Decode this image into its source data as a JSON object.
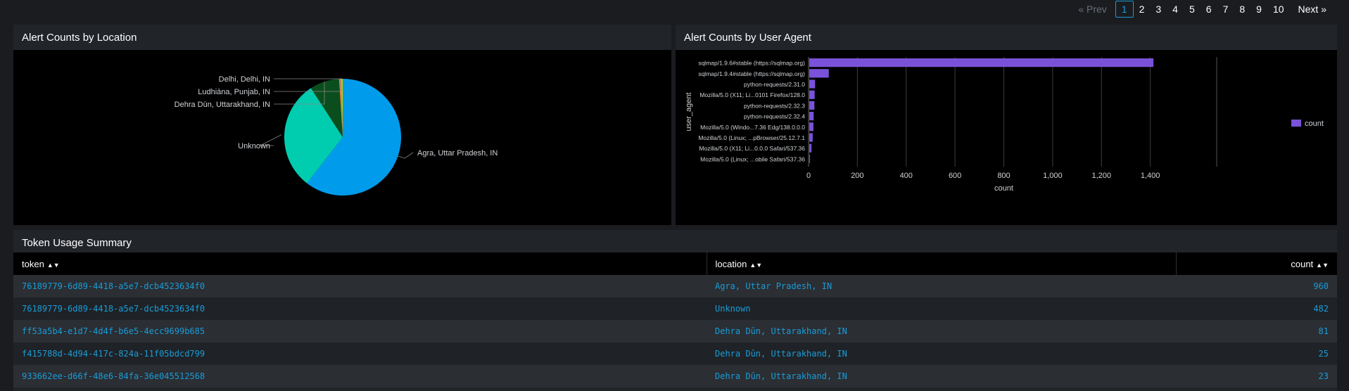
{
  "pagination": {
    "prev": "« Prev",
    "pages": [
      "1",
      "2",
      "3",
      "4",
      "5",
      "6",
      "7",
      "8",
      "9",
      "10"
    ],
    "active_page": "1",
    "next": "Next »"
  },
  "location_panel": {
    "title": "Alert Counts by Location"
  },
  "user_agent_panel": {
    "title": "Alert Counts by User Agent"
  },
  "token_panel": {
    "title": "Token Usage Summary",
    "columns": [
      "token",
      "location",
      "count"
    ],
    "rows": [
      {
        "token": "76189779-6d89-4418-a5e7-dcb4523634f0",
        "location": "Agra, Uttar Pradesh, IN",
        "count": "960"
      },
      {
        "token": "76189779-6d89-4418-a5e7-dcb4523634f0",
        "location": "Unknown",
        "count": "482"
      },
      {
        "token": "ff53a5b4-e1d7-4d4f-b6e5-4ecc9699b685",
        "location": "Dehra Dūn, Uttarakhand, IN",
        "count": "81"
      },
      {
        "token": "f415788d-4d94-417c-824a-11f05bdcd799",
        "location": "Dehra Dūn, Uttarakhand, IN",
        "count": "25"
      },
      {
        "token": "933662ee-d66f-48e6-84fa-36e045512568",
        "location": "Dehra Dūn, Uttarakhand, IN",
        "count": "23"
      }
    ]
  },
  "chart_data": [
    {
      "type": "pie",
      "title": "Alert Counts by Location",
      "categories": [
        "Agra, Uttar Pradesh, IN",
        "Unknown",
        "Dehra Dūn, Uttarakhand, IN",
        "Ludhiāna, Punjab, IN",
        "Delhi, Delhi, IN"
      ],
      "values": [
        960,
        482,
        129,
        10,
        6
      ],
      "colors": [
        "#009ceb",
        "#00cdaf",
        "#0b4e1e",
        "#f1813f",
        "#c4d300"
      ]
    },
    {
      "type": "bar",
      "orientation": "horizontal",
      "title": "Alert Counts by User Agent",
      "categories": [
        "sqlmap/1.9.6#stable (https://sqlmap.org)",
        "sqlmap/1.9.4#stable (https://sqlmap.org)",
        "python-requests/2.31.0",
        "Mozilla/5.0 (X11; Li...0101 Firefox/128.0",
        "python-requests/2.32.3",
        "python-requests/2.32.4",
        "Mozilla/5.0 (Windo...7.36 Edg/138.0.0.0",
        "Mozilla/5.0 (Linux; ...pBrowser/25.12.7.1",
        "Mozilla/5.0 (X11; Li...0.0.0 Safari/537.36",
        "Mozilla/5.0 (Linux; ...obile Safari/537.36"
      ],
      "series": [
        {
          "name": "count",
          "values": [
            1410,
            80,
            24,
            22,
            21,
            18,
            17,
            14,
            9,
            3
          ]
        }
      ],
      "xlabel": "count",
      "ylabel": "user_agent",
      "xticks": [
        "0",
        "200",
        "400",
        "600",
        "800",
        "1,000",
        "1,200",
        "1,400"
      ],
      "xlim": [
        0,
        1600
      ],
      "color": "#7a52d9",
      "grid": true,
      "legend": "right"
    }
  ]
}
